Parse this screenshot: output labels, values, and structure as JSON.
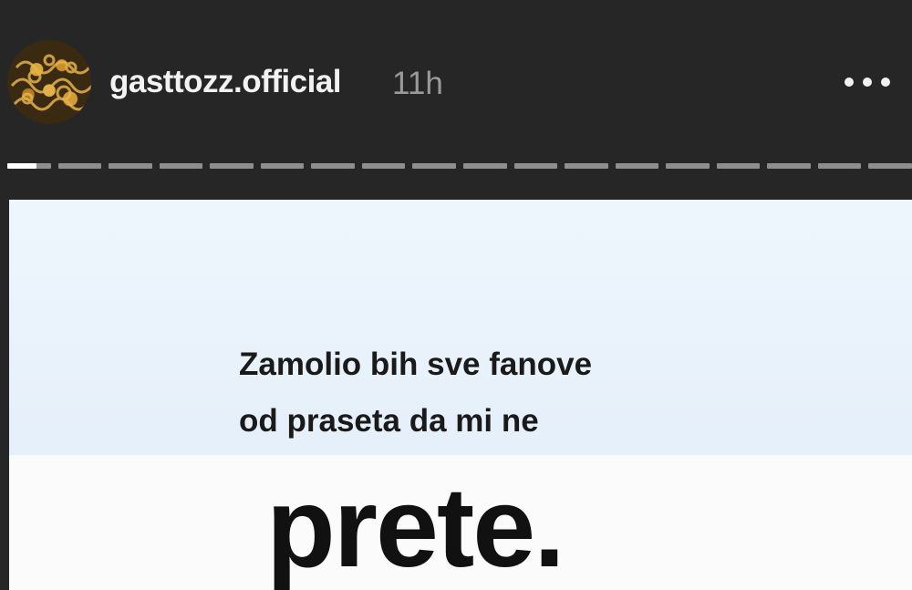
{
  "story_header": {
    "username": "gasttozz.official",
    "time_ago": "11h",
    "avatar_icon": "profile-avatar-gold-pattern",
    "more_icon": "three-dots-horizontal"
  },
  "progress": {
    "segment_count": 18,
    "current_index": 0,
    "current_fill": 0.68,
    "active_color": "#ffffff",
    "inactive_color": "#8e8e8e"
  },
  "story": {
    "caption_lines": [
      "Zamolio bih sve fanove",
      "od praseta da mi ne"
    ],
    "emphasis_word": "prete.",
    "background_color": "#eaf3fc"
  },
  "colors": {
    "app_background": "#262626",
    "username_color": "#f2f2f2",
    "timestamp_color": "#9a9a9a"
  }
}
